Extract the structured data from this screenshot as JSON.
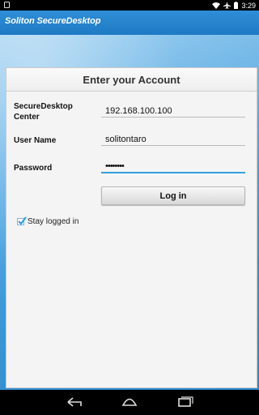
{
  "status_bar": {
    "time": "3:29",
    "icons": [
      "sim-card-icon",
      "wifi-icon",
      "airplane-icon",
      "battery-icon"
    ]
  },
  "app_bar": {
    "title": "Soliton SecureDesktop"
  },
  "form": {
    "title": "Enter your Account",
    "center_label": "SecureDesktop Center",
    "center_value": "192.168.100.100",
    "username_label": "User Name",
    "username_value": "solitontaro",
    "password_label": "Password",
    "password_value": "••••••••",
    "login_label": "Log in",
    "stay_logged_in_label": "Stay logged in",
    "stay_logged_in_checked": true
  },
  "nav_bar": {
    "icons": [
      "back-icon",
      "home-icon",
      "recent-apps-icon"
    ]
  },
  "colors": {
    "app_bar": "#2787d0",
    "accent": "#33a1dd",
    "card_bg": "#f4f4f4"
  }
}
